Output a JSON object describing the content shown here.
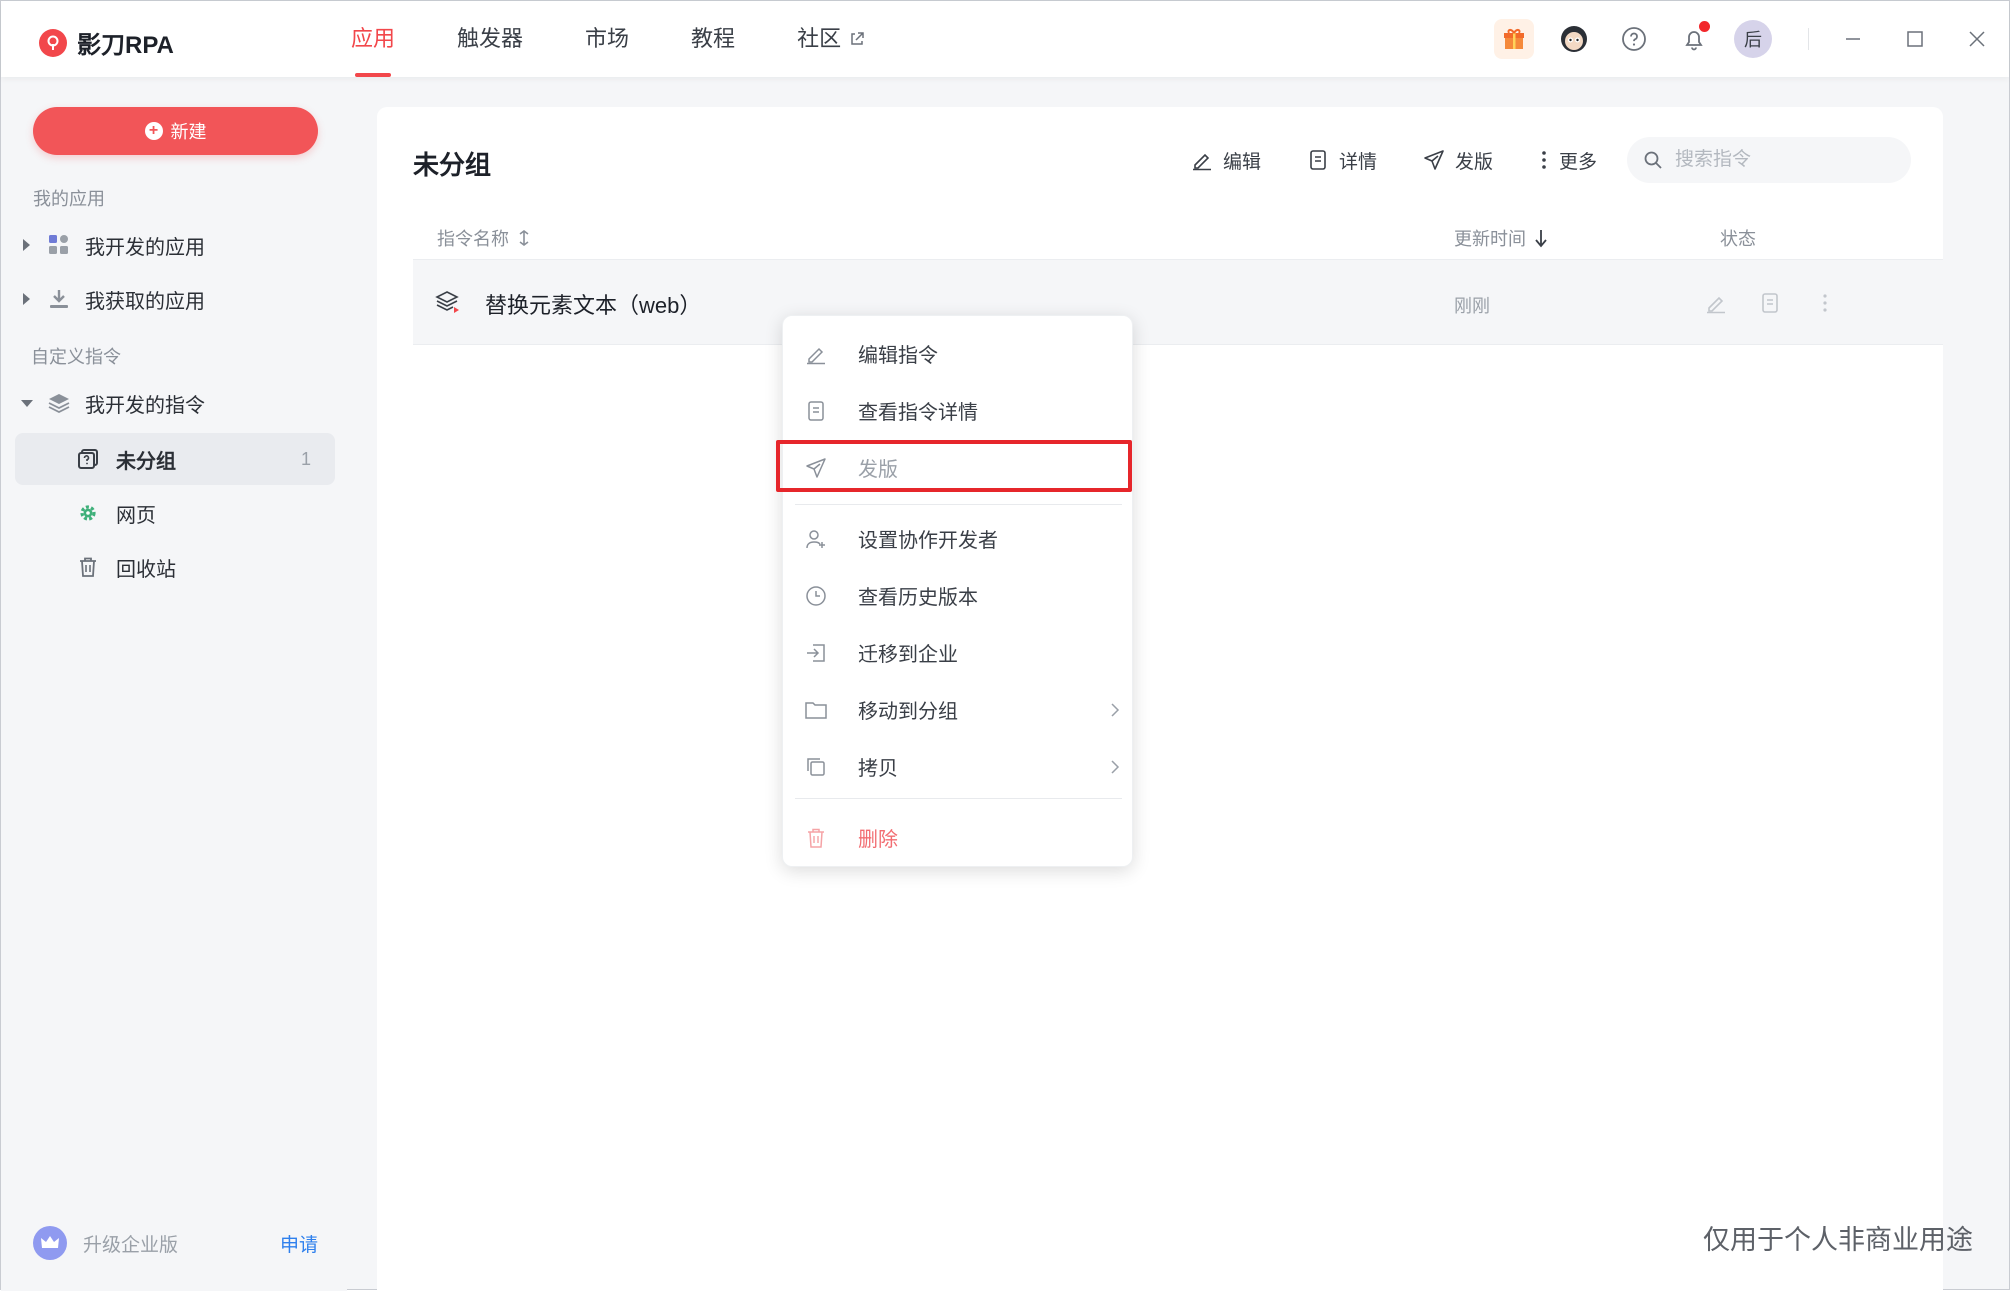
{
  "app": {
    "logo_text": "影刀RPA"
  },
  "nav": {
    "tabs": [
      {
        "label": "应用",
        "active": true
      },
      {
        "label": "触发器"
      },
      {
        "label": "市场"
      },
      {
        "label": "教程"
      },
      {
        "label": "社区",
        "external": true
      }
    ]
  },
  "header_right": {
    "avatar_text": "后",
    "notification_badge": true
  },
  "sidebar": {
    "new_button": "新建",
    "section_my_apps": "我的应用",
    "item_dev_apps": "我开发的应用",
    "item_got_apps": "我获取的应用",
    "section_custom": "自定义指令",
    "item_dev_commands": "我开发的指令",
    "groups": [
      {
        "label": "未分组",
        "count": "1",
        "selected": true
      },
      {
        "label": "网页"
      },
      {
        "label": "回收站"
      }
    ],
    "upgrade_text": "升级企业版",
    "apply_link": "申请"
  },
  "main": {
    "title": "未分组",
    "toolbar": {
      "edit": "编辑",
      "detail": "详情",
      "publish": "发版",
      "more": "更多"
    },
    "search": {
      "placeholder": "搜索指令"
    },
    "table": {
      "columns": {
        "name": "指令名称",
        "updated": "更新时间",
        "status": "状态"
      },
      "rows": [
        {
          "name": "替换元素文本（web）",
          "updated": "刚刚"
        }
      ]
    }
  },
  "context_menu": {
    "items": [
      {
        "label": "编辑指令",
        "icon": "pencil-icon"
      },
      {
        "label": "查看指令详情",
        "icon": "document-icon"
      },
      {
        "label": "发版",
        "icon": "send-icon",
        "highlighted": true
      },
      {
        "label": "设置协作开发者",
        "icon": "user-add-icon"
      },
      {
        "label": "查看历史版本",
        "icon": "clock-icon"
      },
      {
        "label": "迁移到企业",
        "icon": "migrate-icon"
      },
      {
        "label": "移动到分组",
        "icon": "folder-icon",
        "submenu": true
      },
      {
        "label": "拷贝",
        "icon": "copy-icon",
        "submenu": true
      },
      {
        "label": "删除",
        "icon": "trash-icon",
        "danger": true
      }
    ]
  },
  "watermark": "仅用于个人非商业用途",
  "colors": {
    "accent": "#f2474b",
    "highlight": "#e6262b",
    "link": "#2f80ed"
  }
}
